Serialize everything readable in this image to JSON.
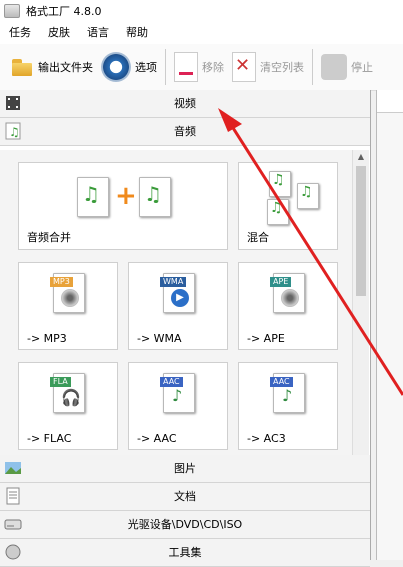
{
  "window": {
    "title": "格式工厂 4.8.0"
  },
  "menu": [
    "任务",
    "皮肤",
    "语言",
    "帮助"
  ],
  "toolbar": {
    "output_folder": "输出文件夹",
    "options": "选项",
    "remove": "移除",
    "clear_list": "清空列表",
    "stop": "停止"
  },
  "categories": {
    "video": "视频",
    "audio": "音频",
    "picture": "图片",
    "document": "文档",
    "disc": "光驱设备\\DVD\\CD\\ISO",
    "tools": "工具集"
  },
  "audio_tiles": [
    {
      "label": "音频合并",
      "icon": "audio-merge-icon"
    },
    {
      "label": "混合",
      "icon": "audio-mix-icon"
    },
    {
      "label": "-> MP3",
      "icon": "mp3-file-icon",
      "badge": "MP3",
      "color": "#e8a23a"
    },
    {
      "label": "-> WMA",
      "icon": "wma-file-icon",
      "badge": "WMA",
      "color": "#2b5e9e"
    },
    {
      "label": "-> APE",
      "icon": "ape-file-icon",
      "badge": "APE",
      "color": "#2f8f8a"
    },
    {
      "label": "-> FLAC",
      "icon": "flac-file-icon",
      "badge": "FLA",
      "color": "#3b9b5a"
    },
    {
      "label": "-> AAC",
      "icon": "aac-file-icon",
      "badge": "AAC",
      "color": "#3a64c2"
    },
    {
      "label": "-> AC3",
      "icon": "ac3-file-icon",
      "badge": "AAC",
      "color": "#3a64c2"
    }
  ],
  "annotation": {
    "arrow_color": "#e02020"
  }
}
